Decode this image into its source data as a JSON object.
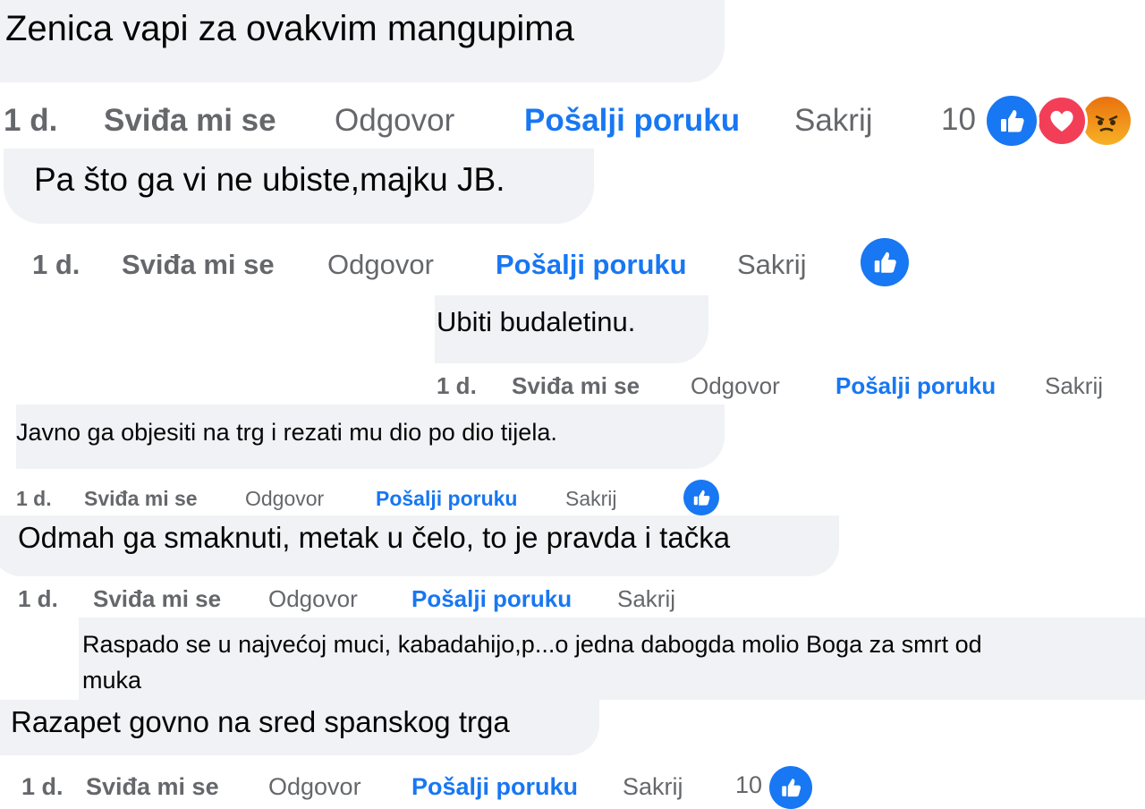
{
  "comments": [
    {
      "text": "Zenica vapi za ovakvim mangupima",
      "actions": {
        "time": "1 d.",
        "like": "Sviđa mi se",
        "reply": "Odgovor",
        "send": "Pošalji poruku",
        "hide": "Sakrij"
      },
      "reaction_count": "10",
      "reactions": [
        "like-icon",
        "love-icon",
        "angry-icon"
      ]
    },
    {
      "text": "Pa što ga vi ne ubiste,majku JB.",
      "actions": {
        "time": "1 d.",
        "like": "Sviđa mi se",
        "reply": "Odgovor",
        "send": "Pošalji poruku",
        "hide": "Sakrij"
      },
      "reactions": [
        "like-icon"
      ]
    },
    {
      "text": "Ubiti budaletinu.",
      "actions": {
        "time": "1 d.",
        "like": "Sviđa mi se",
        "reply": "Odgovor",
        "send": "Pošalji poruku",
        "hide": "Sakrij"
      }
    },
    {
      "text": "Javno ga objesiti na trg i rezati mu dio po dio tijela.",
      "actions": {
        "time": "1 d.",
        "like": "Sviđa mi se",
        "reply": "Odgovor",
        "send": "Pošalji poruku",
        "hide": "Sakrij"
      },
      "reactions": [
        "like-icon"
      ]
    },
    {
      "text": "Odmah ga smaknuti, metak u čelo, to je pravda i tačka",
      "actions": {
        "time": "1 d.",
        "like": "Sviđa mi se",
        "reply": "Odgovor",
        "send": "Pošalji poruku",
        "hide": "Sakrij"
      }
    },
    {
      "text_line1": "Raspado se u najvećoj muci, kabadahijo,p...o jedna dabogda molio Boga za smrt od",
      "text_line2": "muka"
    },
    {
      "text": "Razapet govno na sred spanskog trga",
      "actions": {
        "time": "1 d.",
        "like": "Sviđa mi se",
        "reply": "Odgovor",
        "send": "Pošalji poruku",
        "hide": "Sakrij"
      },
      "reaction_count": "10",
      "reactions": [
        "like-icon"
      ]
    }
  ],
  "colors": {
    "bubble": "#f0f2f5",
    "link": "#1877f2",
    "meta": "#65676b",
    "like": "#1877f2",
    "love": "#f33e58",
    "angry": "#f7b125"
  }
}
